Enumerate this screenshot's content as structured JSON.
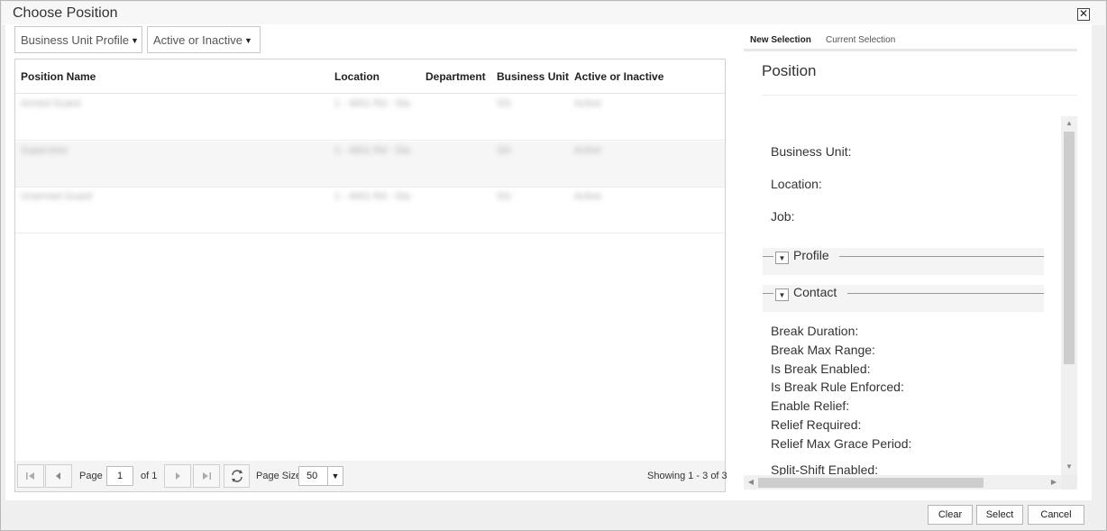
{
  "dialog": {
    "title": "Choose Position",
    "close_glyph": "✕"
  },
  "filters": [
    {
      "label": "Business Unit Profile",
      "caret": "▼"
    },
    {
      "label": "Active or Inactive",
      "caret": "▼"
    }
  ],
  "grid": {
    "columns": [
      "Position Name",
      "Location",
      "Department",
      "Business Unit",
      "Active or Inactive"
    ],
    "rows": [
      {
        "name": "Armed Guard",
        "location": "1 - 4601 Rd - Sta",
        "department": "",
        "business_unit": "SG",
        "status": "Active"
      },
      {
        "name": "Supervisor",
        "location": "1 - 4601 Rd - Sta",
        "department": "",
        "business_unit": "SG",
        "status": "Active"
      },
      {
        "name": "Unarmed Guard",
        "location": "1 - 4601 Rd - Sta",
        "department": "",
        "business_unit": "SG",
        "status": "Active"
      }
    ]
  },
  "pager": {
    "first_icon": "first-page-icon",
    "prev_icon": "prev-page-icon",
    "page_label": "Page",
    "page_value": "1",
    "of_label": "of 1",
    "next_icon": "next-page-icon",
    "last_icon": "last-page-icon",
    "refresh_icon": "refresh-icon",
    "page_size_label": "Page Size",
    "page_size_value": "50",
    "showing": "Showing 1 - 3 of 3"
  },
  "panel": {
    "tabs": [
      "New Selection",
      "Current Selection"
    ],
    "title": "Position",
    "fields_top": [
      "Business Unit:",
      "Location:",
      "Job:"
    ],
    "sections": [
      "Profile",
      "Contact"
    ],
    "fields_bottom": [
      "Break Duration:",
      "Break Max Range:",
      "Is Break Enabled:",
      "Is Break Rule Enforced:",
      "Enable Relief:",
      "Relief Required:",
      "Relief Max Grace Period:",
      "Split-Shift Enabled:"
    ]
  },
  "footer": {
    "clear": "Clear",
    "select": "Select",
    "cancel": "Cancel"
  },
  "colors": {
    "header_bg": "#f7f7f7",
    "grid_alt_row": "#f6f6f6",
    "scrollbar_thumb": "#cdcdcd"
  }
}
